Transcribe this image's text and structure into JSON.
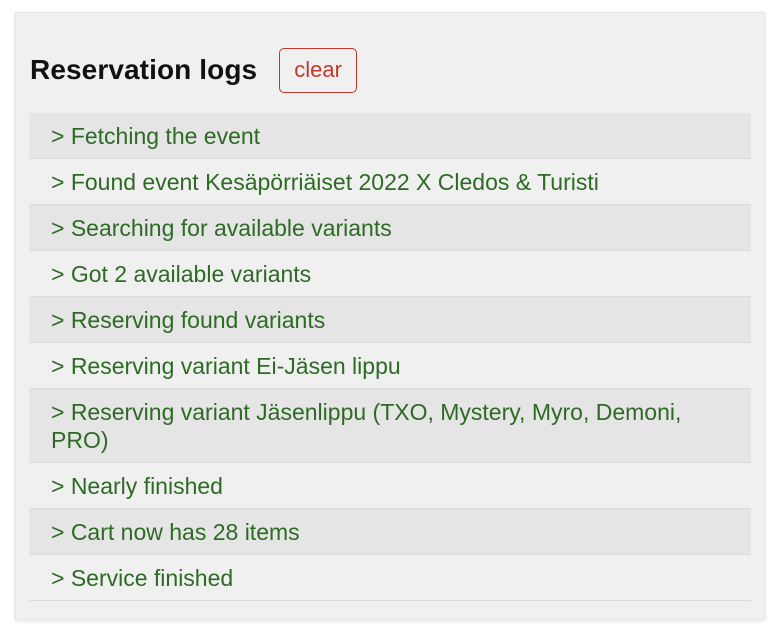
{
  "panel": {
    "title": "Reservation logs",
    "clear_label": "clear"
  },
  "colors": {
    "log_text": "#2d6a24",
    "clear_button": "#c0392b",
    "row_striped": "#e5e5e5",
    "row_plain": "#f0f0f0"
  },
  "logs": [
    "> Fetching the event",
    "> Found event Kesäpörriäiset 2022 X Cledos & Turisti",
    "> Searching for available variants",
    "> Got 2 available variants",
    "> Reserving found variants",
    "> Reserving variant Ei-Jäsen lippu",
    "> Reserving variant Jäsenlippu (TXO, Mystery, Myro, Demoni, PRO)",
    "> Nearly finished",
    "> Cart now has 28 items",
    "> Service finished"
  ]
}
